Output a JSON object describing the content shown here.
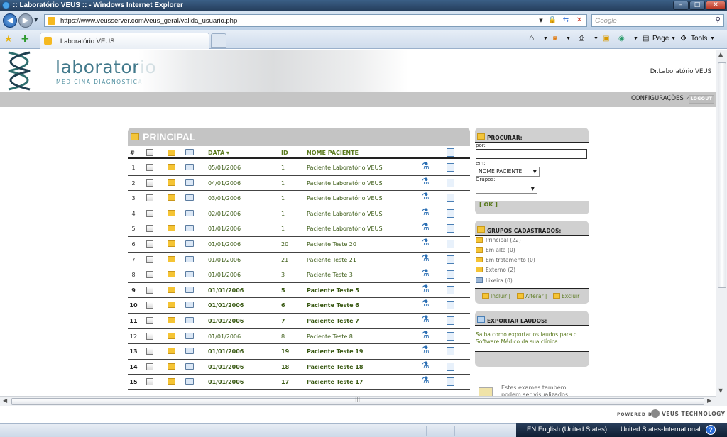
{
  "window": {
    "title": ":: Laboratório VEUS :: - Windows Internet Explorer",
    "controls": {
      "minimize": "–",
      "maximize": "□",
      "close": "✕"
    }
  },
  "addressbar": {
    "url": "https://www.veusserver.com/veus_geral/valida_usuario.php",
    "search_placeholder": "Google"
  },
  "tabbar": {
    "tab_label": ":: Laboratório VEUS ::",
    "commands": {
      "page": "Page",
      "tools": "Tools"
    }
  },
  "header": {
    "logo_main": "laboratorio",
    "logo_sub": "MEDICINA DIAGNÓSTICA",
    "user": "Dr.Laboratório VEUS",
    "config": "CONFIGURAÇÕES",
    "logout": "LOGOUT"
  },
  "main": {
    "title": "PRINCIPAL",
    "columns": {
      "num": "#",
      "date": "DATA",
      "id": "ID",
      "name": "NOME PACIENTE"
    },
    "rows": [
      {
        "num": "1",
        "date": "05/01/2006",
        "id": "1",
        "name": "Paciente Laboratório VEUS",
        "bold": false
      },
      {
        "num": "2",
        "date": "04/01/2006",
        "id": "1",
        "name": "Paciente Laboratório VEUS",
        "bold": false
      },
      {
        "num": "3",
        "date": "03/01/2006",
        "id": "1",
        "name": "Paciente Laboratório VEUS",
        "bold": false
      },
      {
        "num": "4",
        "date": "02/01/2006",
        "id": "1",
        "name": "Paciente Laboratório VEUS",
        "bold": false
      },
      {
        "num": "5",
        "date": "01/01/2006",
        "id": "1",
        "name": "Paciente Laboratório VEUS",
        "bold": false
      },
      {
        "num": "6",
        "date": "01/01/2006",
        "id": "20",
        "name": "Paciente Teste 20",
        "bold": false
      },
      {
        "num": "7",
        "date": "01/01/2006",
        "id": "21",
        "name": "Paciente Teste 21",
        "bold": false
      },
      {
        "num": "8",
        "date": "01/01/2006",
        "id": "3",
        "name": "Paciente Teste 3",
        "bold": false
      },
      {
        "num": "9",
        "date": "01/01/2006",
        "id": "5",
        "name": "Paciente Teste 5",
        "bold": true
      },
      {
        "num": "10",
        "date": "01/01/2006",
        "id": "6",
        "name": "Paciente Teste 6",
        "bold": true
      },
      {
        "num": "11",
        "date": "01/01/2006",
        "id": "7",
        "name": "Paciente Teste 7",
        "bold": true
      },
      {
        "num": "12",
        "date": "01/01/2006",
        "id": "8",
        "name": "Paciente Teste 8",
        "bold": false
      },
      {
        "num": "13",
        "date": "01/01/2006",
        "id": "19",
        "name": "Paciente Teste 19",
        "bold": true
      },
      {
        "num": "14",
        "date": "01/01/2006",
        "id": "18",
        "name": "Paciente Teste 18",
        "bold": true
      },
      {
        "num": "15",
        "date": "01/01/2006",
        "id": "17",
        "name": "Paciente Teste 17",
        "bold": true
      }
    ]
  },
  "search": {
    "title": "PROCURAR:",
    "por_label": "por:",
    "em_label": "em:",
    "em_value": "NOME PACIENTE",
    "grupos_label": "Grupos:",
    "grupos_value": "",
    "ok": "[ OK ]"
  },
  "groups": {
    "title": "GRUPOS CADASTRADOS:",
    "items": [
      {
        "label": "Principal (22)"
      },
      {
        "label": "Em alta (0)"
      },
      {
        "label": "Em tratamento (0)"
      },
      {
        "label": "Externo (2)"
      },
      {
        "label": "Lixeira (0)"
      }
    ],
    "actions": {
      "include": "Incluir",
      "alter": "Alterar",
      "delete": "Excluir"
    }
  },
  "export": {
    "title": "EXPORTAR LAUDOS:",
    "text": "Saiba como exportar os laudos para o Software Médico da sua clínica."
  },
  "tip": {
    "text": "Estes exames também podem ser visualizados"
  },
  "footer": {
    "powered": "POWERED BY",
    "brand": "VEUS TECHNOLOGY"
  },
  "taskbar": {
    "language": "EN English (United States)",
    "keyboard": "United States-International"
  }
}
